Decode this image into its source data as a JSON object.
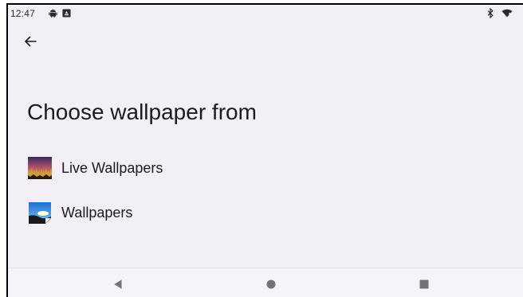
{
  "status_bar": {
    "time": "12:47",
    "icons": [
      "android-icon",
      "notification-icon",
      "bluetooth-icon",
      "wifi-icon"
    ]
  },
  "toolbar": {
    "back_icon": "arrow-left-icon"
  },
  "main": {
    "title": "Choose wallpaper from",
    "options": [
      {
        "label": "Live Wallpapers",
        "icon": "live-wallpapers-icon"
      },
      {
        "label": "Wallpapers",
        "icon": "wallpapers-icon"
      }
    ]
  },
  "nav_bar": {
    "buttons": [
      "back-triangle-icon",
      "home-circle-icon",
      "recents-square-icon"
    ]
  },
  "colors": {
    "background": "#f2eff5",
    "text": "#1c1b1f",
    "nav_icon": "#737373"
  }
}
